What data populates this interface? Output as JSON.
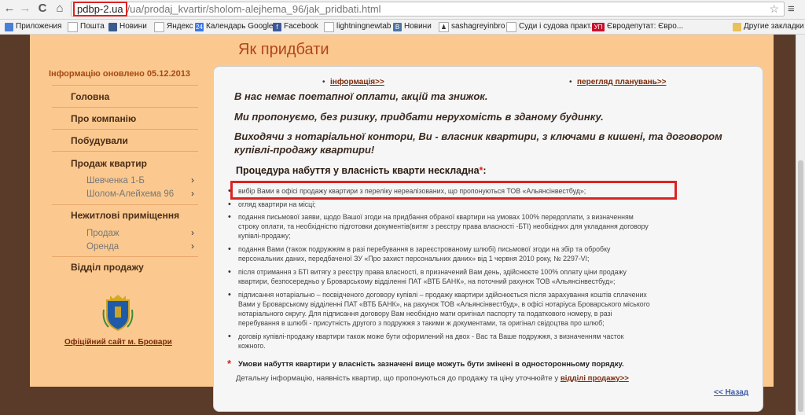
{
  "browser": {
    "url_host": "pdbp-2.ua",
    "url_path": "/ua/prodaj_kvartir/sholom-alejhema_96/jak_pridbati.html",
    "back_glyph": "←",
    "forward_glyph": "→",
    "reload_glyph": "C",
    "home_glyph": "⌂",
    "star_glyph": "☆",
    "menu_glyph": "≡"
  },
  "bookmarks": {
    "items": [
      "Приложения",
      "Пошта",
      "Новини",
      "Яндекс",
      "Календарь Google",
      "Facebook",
      "lightningnewtab",
      "Новини",
      "sashagreyinbro",
      "Суди і судова практ...",
      "Євродепутат: Євро..."
    ],
    "other": "Другие закладки",
    "icon_labels": [
      "",
      "",
      "",
      "",
      "24",
      "f",
      "",
      "B",
      "",
      "",
      "УП"
    ]
  },
  "page": {
    "heading": "Як придбати",
    "updated": "Інформацію оновлено 05.12.2013",
    "menu": [
      "Головна",
      "Про компанію",
      "Побудували",
      "Продаж квартир",
      "Нежитлові приміщення",
      "Відділ продажу"
    ],
    "submenu_sale": [
      "Шевченка 1-Б",
      "Шолом-Алейхема 96"
    ],
    "submenu_nonres": [
      "Продаж",
      "Оренда"
    ],
    "chevron": "›",
    "city_link": "Офіційний сайт м. Бровари"
  },
  "content": {
    "link_info": "інформація>>",
    "link_plans": "перегляд планувань>>",
    "bullet": "•",
    "p1": "В нас немає поетапної оплати, акцій та знижок.",
    "p2": "Ми пропонуємо, без ризику, придбати нерухомість в зданому будинку.",
    "p3a": "Виходячи з нотаріальної контори, Ви - власник квартири, з ключами в кишені, та договором",
    "p3b": "купівлі-продажу квартири!",
    "proc_title": "Процедура набуття у власність кварти нескладна",
    "proc_ast": "*",
    "proc_colon": ":",
    "steps": [
      "вибір Вами в офісі продажу квартири з переліку нереалізованих, що пропонуються ТОВ «Альянсінвестбуд»;",
      "огляд квартири на місці;",
      "подання письмової заяви, щодо Вашої згоди на придбання обраної квартири на умовах 100% передоплати, з визначенням",
      "строку оплати, та необхідністю підготовки документів(витяг з реєстру права власності -БТІ) необхідних для укладання договору",
      "купівлі-продажу;",
      "подання Вами (також подружжям в разі перебування в зареєстрованому шлюбі) письмової згоди на збір та обробку",
      "персональних даних, передбаченої ЗУ «Про захист персональних даних» від 1 червня 2010 року, № 2297-VI;",
      "після отримання з БТІ витягу з реєстру права власності, в призначений Вам день, здійснюєте 100% оплату ціни продажу",
      "квартири, безпосередньо у Броварському відділенні ПАТ «ВТБ БАНК», на поточний рахунок ТОВ «Альянсінвестбуд»;",
      "підписання нотаріально – посвідченого договору купівлі – продажу квартири здійснюється після зарахування коштів сплачених",
      "Вами у Броварському відділенні ПАТ «ВТБ БАНК», на рахунок ТОВ «Альянсінвестбуд», в офісі нотаріуса Броварського міського",
      "нотаріального округу. Для підписання договору Вам необхідно мати оригінал паспорту та податкового номеру, в разі",
      "перебування в шлюбі - присутність другого з подружжя з такими ж документами, та оригінал свідоцтва про шлюб;",
      "договір купівлі-продажу квартири також може бути оформлений на двох - Вас та Ваше подружжя, з визначенням часток",
      "кожного."
    ],
    "cond_ast": "*",
    "cond": "Умови набуття квартири у власність зазначені вище можуть бути змінені в односторонньому порядку.",
    "detail": "Детальну інформацію, наявність квартир, що пропонуються до продажу та ціну уточнюйте у",
    "detail_link": "відділі продажу>>",
    "back": "<< Назад"
  }
}
